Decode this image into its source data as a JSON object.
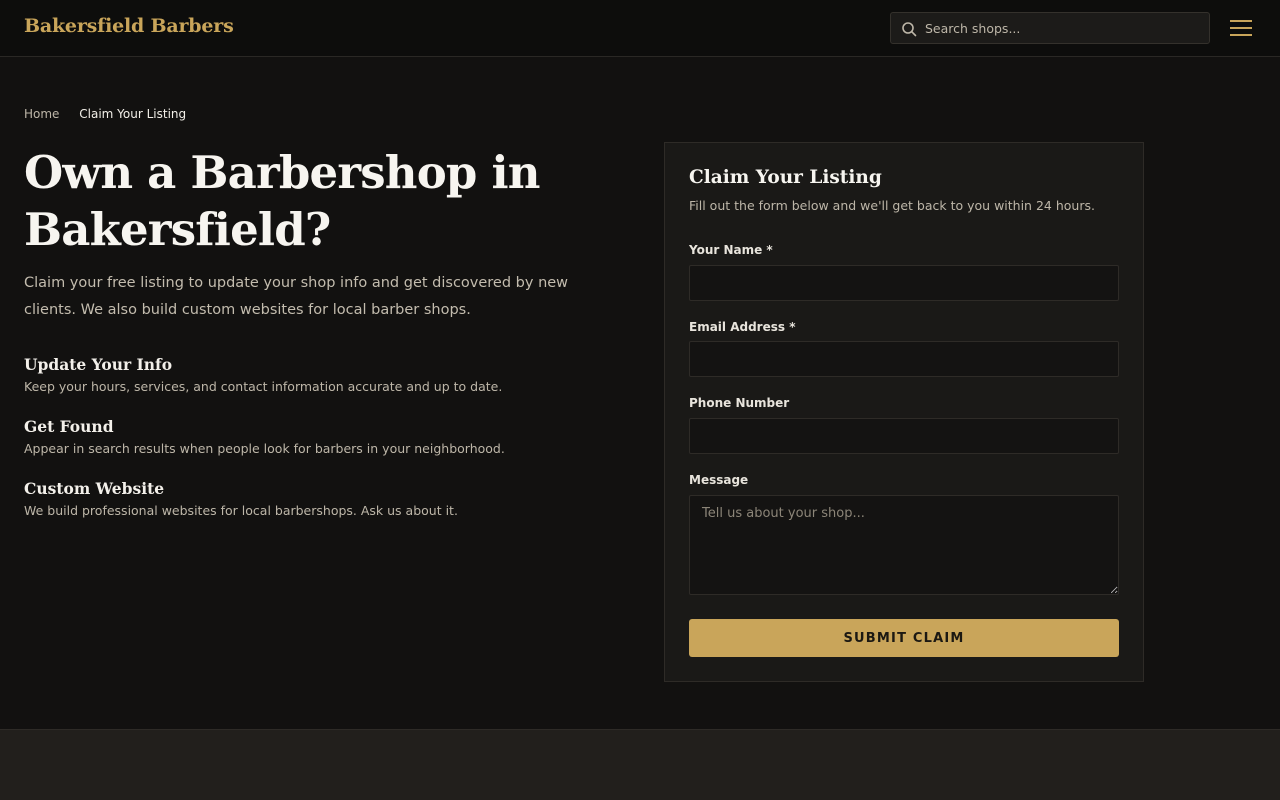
{
  "header": {
    "logo": "Bakersfield Barbers",
    "search": {
      "placeholder": "Search shops...",
      "icon": "search-icon"
    },
    "menu_icon": "hamburger-menu-icon"
  },
  "breadcrumb": {
    "home": "Home",
    "current": "Claim Your Listing"
  },
  "hero": {
    "title": "Own a Barbershop in Bakersfield?",
    "subtitle": "Claim your free listing to update your shop info and get discovered by new clients. We also build custom websites for local barber shops."
  },
  "features": [
    {
      "title": "Update Your Info",
      "text": "Keep your hours, services, and contact information accurate and up to date."
    },
    {
      "title": "Get Found",
      "text": "Appear in search results when people look for barbers in your neighborhood."
    },
    {
      "title": "Custom Website",
      "text": "We build professional websites for local barbershops. Ask us about it."
    }
  ],
  "form": {
    "title": "Claim Your Listing",
    "subtitle": "Fill out the form below and we'll get back to you within 24 hours.",
    "name_label": "Your Name *",
    "email_label": "Email Address *",
    "phone_label": "Phone Number",
    "message_label": "Message",
    "message_placeholder": "Tell us about your shop...",
    "submit_label": "SUBMIT CLAIM"
  },
  "colors": {
    "accent": "#c9a55a",
    "background": "#121110",
    "card": "#1a1917"
  }
}
